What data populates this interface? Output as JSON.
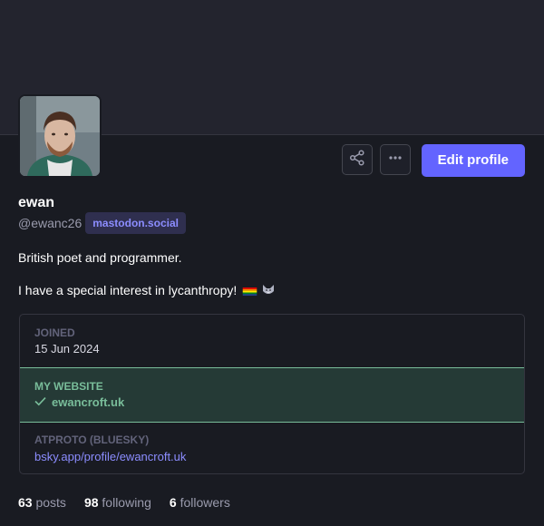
{
  "profile": {
    "display_name": "ewan",
    "handle": "@ewanc26",
    "domain": "mastodon.social",
    "bio": [
      "British poet and programmer.",
      "I have a special interest in lycanthropy!"
    ]
  },
  "actions": {
    "share_icon": "share-icon",
    "more_icon": "more-horizontal-icon",
    "edit_label": "Edit profile"
  },
  "fields": [
    {
      "label": "Joined",
      "value": "15 Jun 2024",
      "verified": false
    },
    {
      "label": "My website",
      "value": "ewancroft.uk",
      "verified": true
    },
    {
      "label": "ATPROTO (BLUESKY)",
      "value": "bsky.app/profile/ewancroft.uk",
      "verified": false
    }
  ],
  "stats": {
    "posts": {
      "count": "63",
      "label": "posts"
    },
    "following": {
      "count": "98",
      "label": "following"
    },
    "followers": {
      "count": "6",
      "label": "followers"
    }
  },
  "colors": {
    "background": "#191b22",
    "accent": "#6364ff",
    "verified": "#79bd9a",
    "link": "#8c8dff"
  }
}
